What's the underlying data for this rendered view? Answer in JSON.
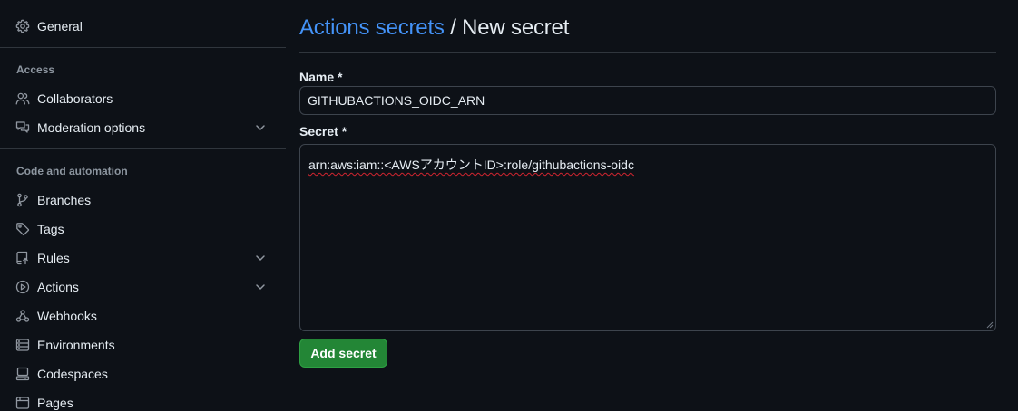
{
  "sidebar": {
    "top_item": {
      "label": "General",
      "icon": "gear-icon"
    },
    "sections": [
      {
        "heading": "Access",
        "items": [
          {
            "label": "Collaborators",
            "icon": "people-icon",
            "expandable": false
          },
          {
            "label": "Moderation options",
            "icon": "comment-discussion-icon",
            "expandable": true
          }
        ]
      },
      {
        "heading": "Code and automation",
        "items": [
          {
            "label": "Branches",
            "icon": "git-branch-icon",
            "expandable": false
          },
          {
            "label": "Tags",
            "icon": "tag-icon",
            "expandable": false
          },
          {
            "label": "Rules",
            "icon": "repo-push-icon",
            "expandable": true
          },
          {
            "label": "Actions",
            "icon": "play-icon",
            "expandable": true
          },
          {
            "label": "Webhooks",
            "icon": "webhook-icon",
            "expandable": false
          },
          {
            "label": "Environments",
            "icon": "server-icon",
            "expandable": false
          },
          {
            "label": "Codespaces",
            "icon": "codespaces-icon",
            "expandable": false
          },
          {
            "label": "Pages",
            "icon": "browser-icon",
            "expandable": false
          }
        ]
      }
    ]
  },
  "breadcrumb": {
    "parent": "Actions secrets",
    "separator": " / ",
    "current": "New secret"
  },
  "form": {
    "name_label": "Name *",
    "name_value": "GITHUBACTIONS_OIDC_ARN",
    "secret_label": "Secret *",
    "secret_value": "arn:aws:iam::<AWSアカウントID>:role/githubactions-oidc",
    "submit_label": "Add secret"
  },
  "colors": {
    "background": "#0d1117",
    "link": "#4493f8",
    "primary_button": "#238636",
    "border": "#30363d",
    "muted_text": "#8d96a0",
    "spellcheck_underline": "#d1242f"
  }
}
